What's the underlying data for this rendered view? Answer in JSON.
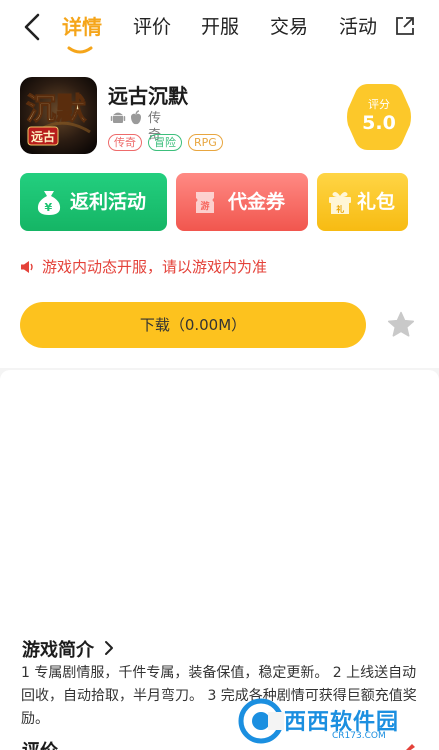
{
  "topbar": {
    "tabs": [
      {
        "label": "详情",
        "active": true
      },
      {
        "label": "评价",
        "active": false
      },
      {
        "label": "开服",
        "active": false
      },
      {
        "label": "交易",
        "active": false
      },
      {
        "label": "活动",
        "active": false
      }
    ],
    "icons": {
      "back": "back-arrow-icon",
      "share": "share-icon"
    }
  },
  "game": {
    "name": "远古沉默",
    "icon_text": "沉默",
    "icon_badge": "远古",
    "platforms": [
      "android-icon",
      "apple-icon"
    ],
    "type": "传奇",
    "tags": [
      "传奇",
      "冒险",
      "RPG"
    ],
    "score_label": "评分",
    "score": "5.0"
  },
  "actions": {
    "rebate": "返利活动",
    "voucher": "代金券",
    "voucher_icon_text": "游",
    "gift": "礼包",
    "gift_icon_text": "礼"
  },
  "notice": {
    "text": "游戏内动态开服，请以游戏内为准"
  },
  "download": {
    "label": "下载（0.00M）"
  },
  "intro": {
    "title": "游戏简介",
    "description": "1 专属剧情服，千件专属，装备保值，稳定更新。 2 上线送自动回收，自动拾取，半月弯刀。 3 完成各种剧情可获得巨额充值奖励。"
  },
  "reviews": {
    "title": "评价"
  },
  "watermark": {
    "text": "西西软件园",
    "sub": "CR173.COM"
  },
  "colors": {
    "accent": "#f5a51a",
    "download": "#fdc21e",
    "rebate": "#1ec472",
    "voucher": "#f6665e",
    "gift": "#fcc82a",
    "notice": "#e4423a"
  }
}
